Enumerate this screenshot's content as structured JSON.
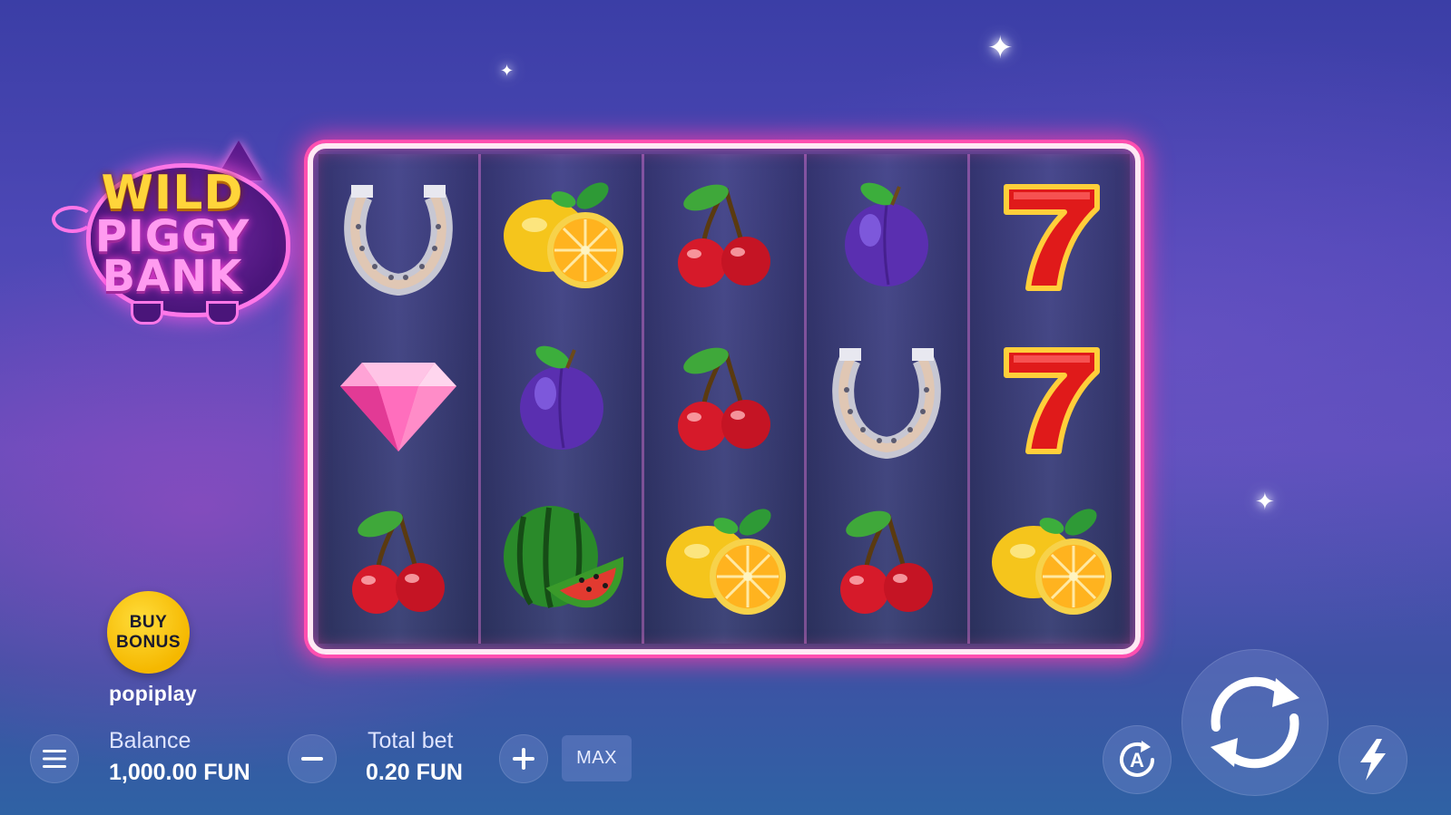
{
  "game": {
    "logo": {
      "line1": "WILD",
      "line2": "PIGGY",
      "line3": "BANK"
    },
    "provider": "popiplay"
  },
  "reels": [
    [
      "horseshoe",
      "diamond",
      "cherry"
    ],
    [
      "lemon",
      "plum",
      "watermelon"
    ],
    [
      "cherry",
      "cherry",
      "lemon"
    ],
    [
      "plum",
      "horseshoe",
      "cherry"
    ],
    [
      "seven",
      "seven",
      "lemon"
    ]
  ],
  "buy_bonus": {
    "line1": "BUY",
    "line2": "BONUS"
  },
  "footer": {
    "balance_label": "Balance",
    "balance_value": "1,000.00 FUN",
    "bet_label": "Total bet",
    "bet_value": "0.20 FUN",
    "max_label": "MAX",
    "auto_letter": "A"
  },
  "icons": {
    "menu": "hamburger-icon",
    "minus": "minus-icon",
    "plus": "plus-icon",
    "autoplay": "autoplay-icon",
    "spin": "spin-icon",
    "turbo": "lightning-icon"
  },
  "colors": {
    "reel_frame": "#ff4fb0",
    "buy_bonus": "#f7c400",
    "logo_gold": "#ffd53a",
    "logo_pink": "#ff9bf0"
  }
}
